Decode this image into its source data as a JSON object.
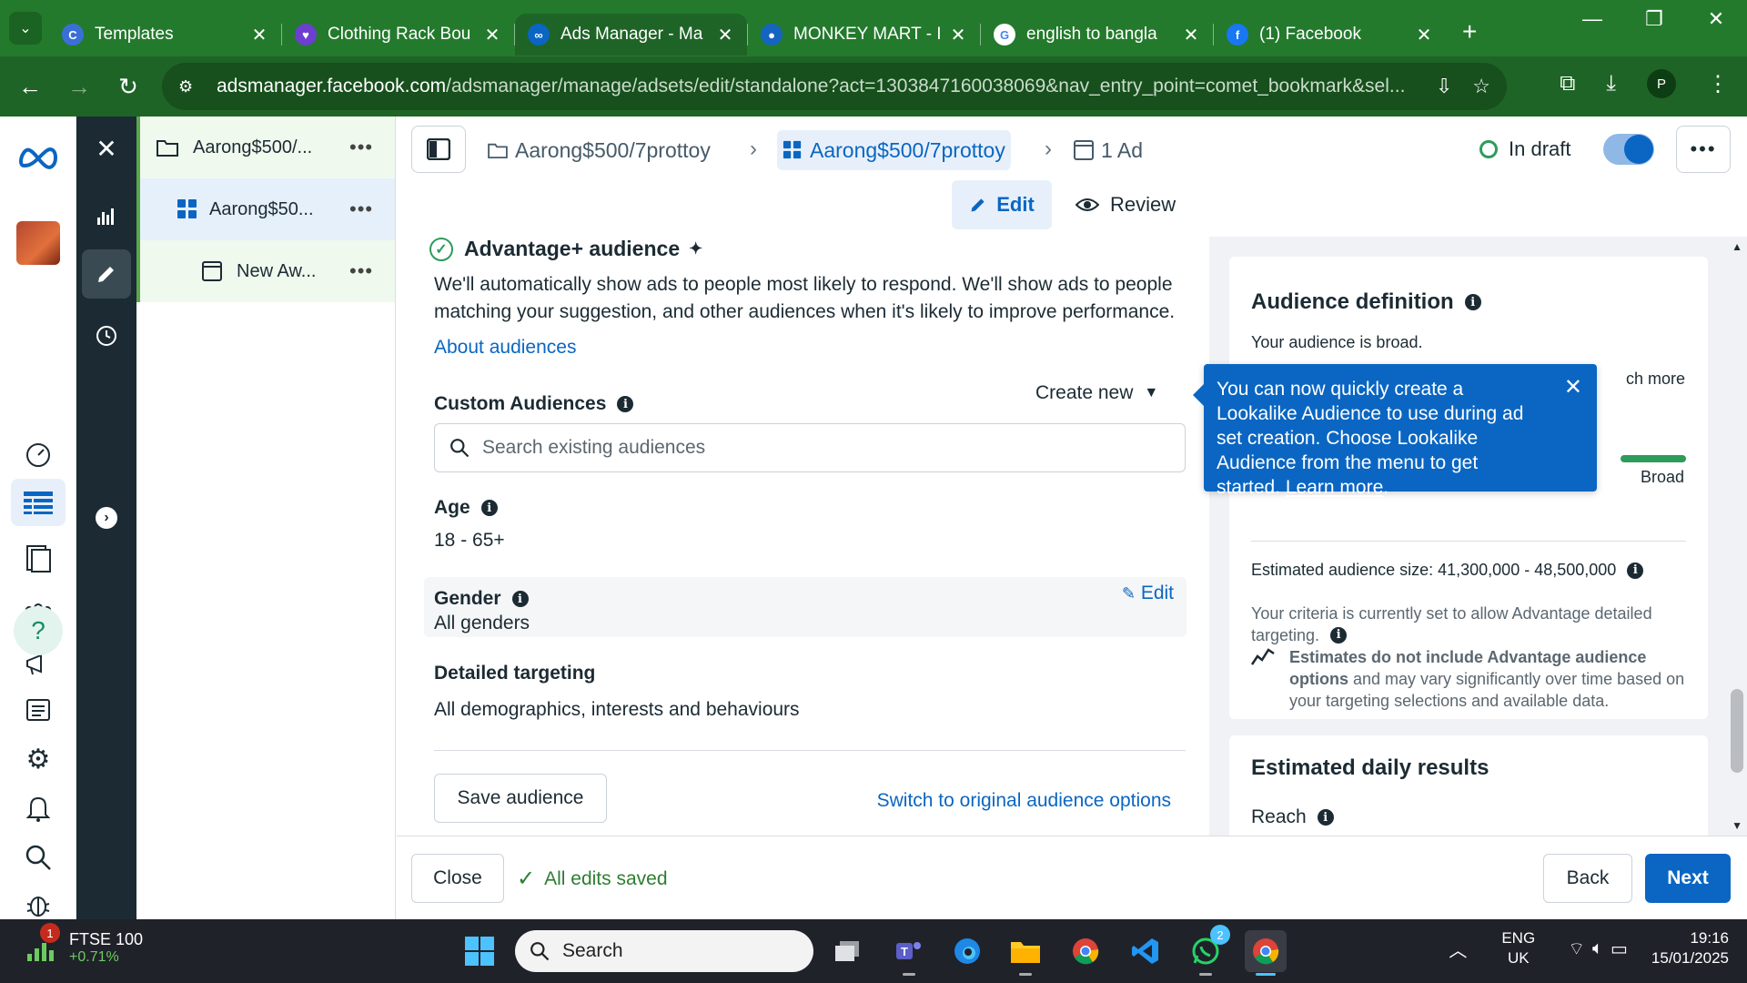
{
  "browser": {
    "tabs": [
      {
        "title": "Templates",
        "favicon_color": "#3b6fd8",
        "favicon_letter": "C"
      },
      {
        "title": "Clothing Rack Bou",
        "favicon_color": "#6c3fd0",
        "favicon_letter": "♥"
      },
      {
        "title": "Ads Manager - Ma",
        "favicon_color": "#0a66c2",
        "favicon_letter": "∞"
      },
      {
        "title": "MONKEY MART - I",
        "favicon_color": "#1565c0",
        "favicon_letter": "●"
      },
      {
        "title": "english to bangla",
        "favicon_color": "#ffffff",
        "favicon_letter": "G"
      },
      {
        "title": "(1) Facebook",
        "favicon_color": "#1877f2",
        "favicon_letter": "f"
      }
    ],
    "active_tab_index": 2,
    "url_host": "adsmanager.facebook.com",
    "url_path": "/adsmanager/manage/adsets/edit/standalone?act=1303847160038069&nav_entry_point=comet_bookmark&sel...",
    "profile_initial": "P"
  },
  "tree": {
    "items": [
      {
        "label": "Aarong$500/...",
        "icon": "folder-icon"
      },
      {
        "label": "Aarong$50...",
        "icon": "adset-grid-icon"
      },
      {
        "label": "New Aw...",
        "icon": "ad-icon"
      }
    ]
  },
  "header": {
    "crumb_campaign": "Aarong$500/7prottoy",
    "crumb_adset": "Aarong$500/7prottoy",
    "crumb_ad": "1 Ad",
    "status": "In draft",
    "edit_tab": "Edit",
    "review_tab": "Review"
  },
  "audience": {
    "title": "Advantage+ audience",
    "description": "We'll automatically show ads to people most likely to respond. We'll show ads to people matching your suggestion, and other audiences when it's likely to improve performance.",
    "about_link": "About audiences",
    "custom_label": "Custom Audiences",
    "create_new": "Create new",
    "search_placeholder": "Search existing audiences",
    "age_label": "Age",
    "age_value": "18 - 65+",
    "gender_label": "Gender",
    "gender_value": "All genders",
    "gender_edit": "Edit",
    "detailed_label": "Detailed targeting",
    "detailed_value": "All demographics, interests and behaviours",
    "save_button": "Save audience",
    "switch_link": "Switch to original audience options"
  },
  "definition": {
    "title": "Audience definition",
    "broad_text": "Your audience is broad.",
    "partial_more": "ch more",
    "meter_label": "Broad",
    "size_text": "Estimated audience size: 41,300,000 - 48,500,000",
    "criteria_line1": "Your criteria is currently set to allow Advantage detailed",
    "criteria_line2": "targeting.",
    "estimates_bold1": "Estimates do not include Advantage audience",
    "estimates_bold2": "options",
    "estimates_rest1": " and may vary significantly over time based on",
    "estimates_rest2": "your targeting selections and available data."
  },
  "daily": {
    "title": "Estimated daily results",
    "reach_label": "Reach"
  },
  "tooltip": {
    "text": "You can now quickly create a Lookalike Audience to use during ad set creation. Choose Lookalike Audience from the menu to get started. ",
    "link": "Learn more",
    "trailing": "."
  },
  "footer": {
    "close": "Close",
    "saved": "All edits saved",
    "back": "Back",
    "next": "Next"
  },
  "taskbar": {
    "ticker_name": "FTSE 100",
    "ticker_change": "+0.71%",
    "ticker_badge": "1",
    "search": "Search",
    "whatsapp_badge": "2",
    "lang_line1": "ENG",
    "lang_line2": "UK",
    "time": "19:16",
    "date": "15/01/2025"
  }
}
